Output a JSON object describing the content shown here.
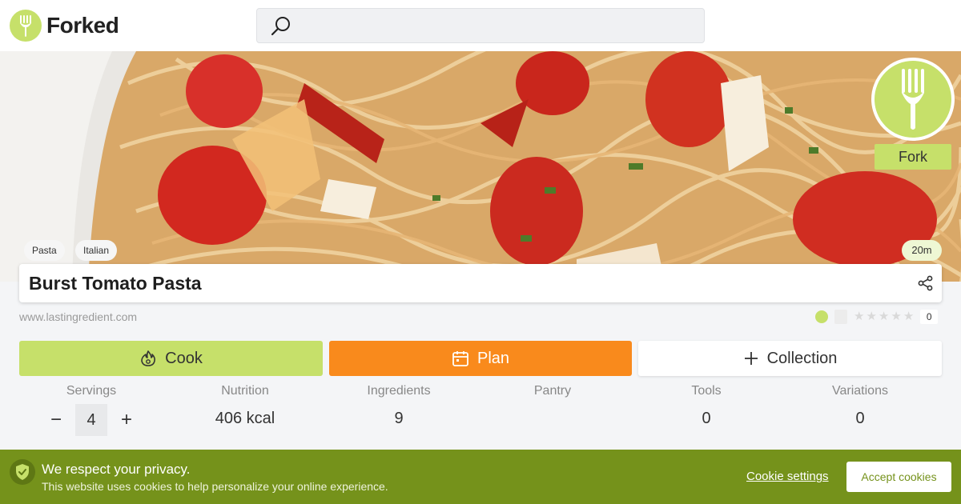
{
  "app": {
    "name": "Forked"
  },
  "search": {
    "placeholder": ""
  },
  "hero": {
    "tags": [
      "Pasta",
      "Italian"
    ],
    "time": "20m",
    "fork_label": "Fork"
  },
  "recipe": {
    "title": "Burst Tomato Pasta",
    "source": "www.lastingredient.com",
    "rating_count": "0"
  },
  "actions": {
    "cook": "Cook",
    "plan": "Plan",
    "collection": "Collection"
  },
  "stats": {
    "servings": {
      "label": "Servings",
      "value": "4",
      "minus": "−",
      "plus": "+"
    },
    "nutrition": {
      "label": "Nutrition",
      "value": "406 kcal"
    },
    "ingredients": {
      "label": "Ingredients",
      "value": "9"
    },
    "pantry": {
      "label": "Pantry",
      "value": ""
    },
    "tools": {
      "label": "Tools",
      "value": "0"
    },
    "variations": {
      "label": "Variations",
      "value": "0"
    }
  },
  "cookie": {
    "title": "We respect your privacy.",
    "text": "This website uses cookies to help personalize your online experience.",
    "settings": "Cookie settings",
    "accept": "Accept cookies"
  },
  "colors": {
    "brand_green": "#c6e06a",
    "plan_orange": "#f98a1c",
    "cookie_green": "#75921b"
  },
  "icons": {
    "logo": "fork-icon",
    "search": "search-icon",
    "share": "share-icon",
    "cook": "flame-icon",
    "plan": "calendar-icon",
    "collection": "plus-icon",
    "privacy": "shield-check-icon"
  }
}
